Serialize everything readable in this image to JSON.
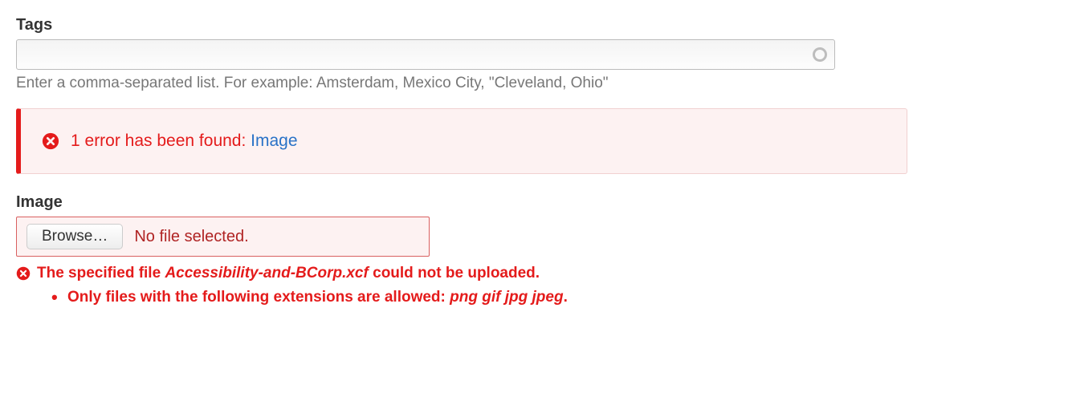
{
  "tags": {
    "label": "Tags",
    "value": "",
    "help": "Enter a comma-separated list. For example: Amsterdam, Mexico City, \"Cleveland, Ohio\""
  },
  "error_banner": {
    "prefix": "1 error has been found: ",
    "link_text": "Image"
  },
  "image_field": {
    "label": "Image",
    "browse_label": "Browse…",
    "status": "No file selected.",
    "error_prefix": "The specified file ",
    "error_filename": "Accessibility-and-BCorp.xcf",
    "error_suffix": " could not be uploaded.",
    "sub_error_prefix": "Only files with the following extensions are allowed: ",
    "sub_error_extensions": "png gif jpg jpeg",
    "sub_error_suffix": "."
  }
}
